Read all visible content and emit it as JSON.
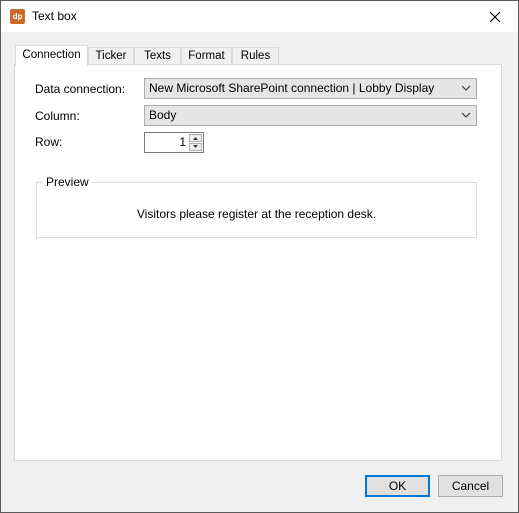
{
  "window": {
    "title": "Text box",
    "app_icon_text": "dp"
  },
  "tabs": [
    {
      "label": "Connection",
      "active": true
    },
    {
      "label": "Ticker",
      "active": false
    },
    {
      "label": "Texts",
      "active": false
    },
    {
      "label": "Format",
      "active": false
    },
    {
      "label": "Rules",
      "active": false
    }
  ],
  "connection": {
    "data_connection_label": "Data connection:",
    "data_connection_value": "New Microsoft SharePoint connection | Lobby Display",
    "column_label": "Column:",
    "column_value": "Body",
    "row_label": "Row:",
    "row_value": "1"
  },
  "preview": {
    "title": "Preview",
    "text": "Visitors please register at the reception desk."
  },
  "buttons": {
    "ok_label": "OK",
    "cancel_label": "Cancel"
  },
  "colors": {
    "accent": "#0078d7",
    "app_icon": "#c96a2c"
  }
}
